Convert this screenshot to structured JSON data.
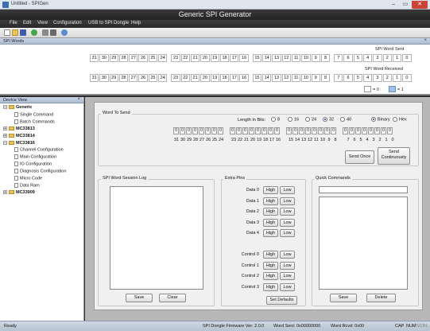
{
  "window": {
    "title": "Untitled - SPIGen",
    "app_title": "Generic SPI Generator",
    "controls": [
      "–",
      "▭",
      "✕"
    ]
  },
  "menu": [
    "File",
    "Edit",
    "View",
    "Configuration",
    "USB to SPI Dongle",
    "Help"
  ],
  "toolbar": {
    "icons": [
      "new-file-icon",
      "open-folder-icon",
      "save-icon",
      "arrow-icon",
      "settings-icon",
      "print-icon",
      "help-icon"
    ]
  },
  "spi_words": {
    "panel_title": "SPI Words",
    "sent_label": "SPI Word Sent",
    "received_label": "SPI Word Received",
    "bit_numbers": [
      "31",
      "30",
      "29",
      "28",
      "27",
      "26",
      "25",
      "24",
      "23",
      "22",
      "21",
      "20",
      "19",
      "18",
      "17",
      "16",
      "15",
      "14",
      "13",
      "12",
      "11",
      "10",
      "9",
      "8",
      "7",
      "6",
      "5",
      "4",
      "3",
      "2",
      "1",
      "0"
    ],
    "legend_zero": "= 0",
    "legend_one": "= 1"
  },
  "device_view": {
    "title": "Device View",
    "tree": [
      {
        "label": "Generic",
        "type": "folder",
        "level": 0,
        "expanded": true
      },
      {
        "label": "Single Command",
        "type": "doc",
        "level": 1
      },
      {
        "label": "Batch Commands",
        "type": "doc",
        "level": 1
      },
      {
        "label": "MC33813",
        "type": "folder",
        "level": 0,
        "expanded": false
      },
      {
        "label": "MC33814",
        "type": "folder",
        "level": 0,
        "expanded": false
      },
      {
        "label": "MC33816",
        "type": "folder",
        "level": 0,
        "expanded": true
      },
      {
        "label": "Channel Configuration",
        "type": "doc",
        "level": 1
      },
      {
        "label": "Main Configuration",
        "type": "doc",
        "level": 1
      },
      {
        "label": "IO Configuration",
        "type": "doc",
        "level": 1
      },
      {
        "label": "Diagnosis Configuration",
        "type": "doc",
        "level": 1
      },
      {
        "label": "Micro Code",
        "type": "doc",
        "level": 1
      },
      {
        "label": "Data Ram",
        "type": "doc",
        "level": 1
      },
      {
        "label": "MC33909",
        "type": "folder",
        "level": 0,
        "expanded": false
      }
    ]
  },
  "word_to_send": {
    "title": "Word To Send",
    "length_label": "Length In Bits:",
    "lengths": [
      "8",
      "16",
      "24",
      "32",
      "40"
    ],
    "selected_length": "32",
    "format_options": [
      "Binary",
      "Hex"
    ],
    "selected_format": "Binary",
    "bits": [
      "0",
      "0",
      "0",
      "0",
      "0",
      "0",
      "0",
      "0",
      "0",
      "0",
      "0",
      "0",
      "0",
      "0",
      "0",
      "0",
      "0",
      "0",
      "0",
      "0",
      "0",
      "0",
      "0",
      "0",
      "0",
      "0",
      "0",
      "0",
      "0",
      "0",
      "0",
      "0"
    ],
    "bit_numbers": [
      "31",
      "30",
      "29",
      "28",
      "27",
      "26",
      "25",
      "24",
      "23",
      "22",
      "21",
      "20",
      "19",
      "18",
      "17",
      "16",
      "15",
      "14",
      "13",
      "12",
      "11",
      "10",
      "9",
      "8",
      "7",
      "6",
      "5",
      "4",
      "3",
      "2",
      "1",
      "0"
    ],
    "send_once": "Send Once",
    "send_continuously": "Send Continuously"
  },
  "session_log": {
    "title": "SPI Word Session Log",
    "save": "Save",
    "clear": "Clear"
  },
  "extra_pins": {
    "title": "Extra Pins",
    "data_pins": [
      "Data 0",
      "Data 1",
      "Data 2",
      "Data 3",
      "Data 4"
    ],
    "control_pins": [
      "Control 0",
      "Control 1",
      "Control 2",
      "Control 3"
    ],
    "high": "High",
    "low": "Low",
    "set_defaults": "Set Defaults"
  },
  "quick_commands": {
    "title": "Quick Commands",
    "save": "Save",
    "delete": "Delete"
  },
  "status_bar": {
    "ready": "Ready",
    "firmware": "SPI Dongle Firmware Ver: 2.0.0",
    "word_sent": "Word Sent: 0x00000000",
    "word_rcvd": "Word Rcvd: 0x00",
    "caps": "CAP",
    "num": "NUM",
    "scrl": "SCRL"
  },
  "colors": {
    "accent": "#3a66b3",
    "bit_one": "#9fc1ee",
    "header_bg": "#2a2a2a",
    "panel_header": "#b6c4d6"
  }
}
